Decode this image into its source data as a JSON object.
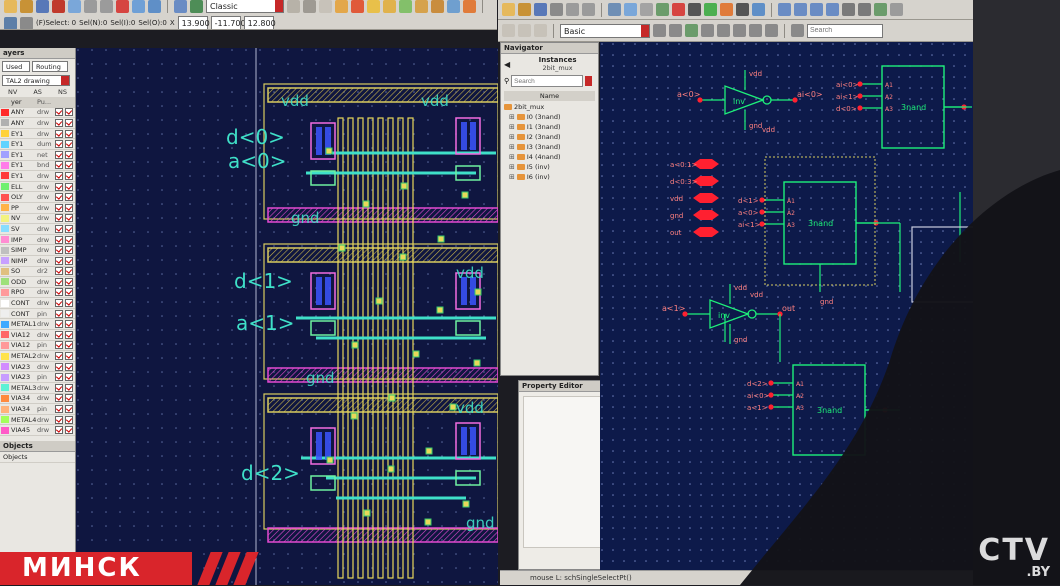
{
  "layout_toolbar": {
    "view_combo": "Classic",
    "coord_labels": [
      "(F)Select: 0",
      "Sel(N):0",
      "Sel(I):0",
      "Sel(O):0",
      "X"
    ],
    "x_value": "13.900",
    "y_value": "-11.700",
    "dist_value": "12.800"
  },
  "schematic_toolbar": {
    "view_combo": "Basic",
    "search_placeholder": "Search"
  },
  "layers_panel": {
    "title": "ayers",
    "filter_used": "Used",
    "filter_routing": "Routing",
    "lpp_combo": "TAL2 drawing",
    "columns": [
      "NV",
      "AS",
      "NS"
    ],
    "header_name": "yer",
    "header_purpose": "Pu...",
    "rows": [
      {
        "name": "ANY",
        "purpose": "drw",
        "color": "#ff2a2a"
      },
      {
        "name": "ANY",
        "purpose": "drw",
        "color": "#b0b0b0"
      },
      {
        "name": "EY1",
        "purpose": "drw",
        "color": "#ffd23a"
      },
      {
        "name": "EY1",
        "purpose": "dum",
        "color": "#5fd3ff"
      },
      {
        "name": "EY1",
        "purpose": "net",
        "color": "#a0a0ff"
      },
      {
        "name": "EY1",
        "purpose": "bnd",
        "color": "#ff7de9"
      },
      {
        "name": "EY1",
        "purpose": "drw",
        "color": "#ff3a3a"
      },
      {
        "name": "ELL",
        "purpose": "drw",
        "color": "#70f070"
      },
      {
        "name": "OLY",
        "purpose": "drw",
        "color": "#ff5050"
      },
      {
        "name": "PP",
        "purpose": "drw",
        "color": "#ffb347"
      },
      {
        "name": "NV",
        "purpose": "drw",
        "color": "#f3f380"
      },
      {
        "name": "SV",
        "purpose": "drw",
        "color": "#88ddff"
      },
      {
        "name": "IMP",
        "purpose": "drw",
        "color": "#ff8cd2"
      },
      {
        "name": "SIMP",
        "purpose": "drw",
        "color": "#bfbfbf"
      },
      {
        "name": "NIMP",
        "purpose": "drw",
        "color": "#c7a0ff"
      },
      {
        "name": "SO",
        "purpose": "dr2",
        "color": "#e0c080"
      },
      {
        "name": "ODD",
        "purpose": "drw",
        "color": "#9fe07a"
      },
      {
        "name": "RPO",
        "purpose": "drw",
        "color": "#ff9a9a"
      },
      {
        "name": "CONT",
        "purpose": "drw",
        "color": "#ffffff"
      },
      {
        "name": "CONT",
        "purpose": "pin",
        "color": "#eeeeee"
      },
      {
        "name": "METAL1",
        "purpose": "drw",
        "color": "#3fa9ff"
      },
      {
        "name": "VIA12",
        "purpose": "drw",
        "color": "#ff6666"
      },
      {
        "name": "VIA12",
        "purpose": "pin",
        "color": "#ff9999"
      },
      {
        "name": "METAL2",
        "purpose": "drw",
        "color": "#ffe34a"
      },
      {
        "name": "VIA23",
        "purpose": "drw",
        "color": "#d28cff"
      },
      {
        "name": "VIA23",
        "purpose": "pin",
        "color": "#c79cff"
      },
      {
        "name": "METAL3",
        "purpose": "drw",
        "color": "#5ff2d5"
      },
      {
        "name": "VIA34",
        "purpose": "drw",
        "color": "#ff8a3d"
      },
      {
        "name": "VIA34",
        "purpose": "pin",
        "color": "#ffb27a"
      },
      {
        "name": "METAL4",
        "purpose": "drw",
        "color": "#a3ff5a"
      },
      {
        "name": "VIA45",
        "purpose": "drw",
        "color": "#ff5ac8"
      }
    ],
    "objects_label": "Objects",
    "objects_sub": "Objects"
  },
  "layout_canvas": {
    "pin_labels": [
      "d<0>",
      "a<0>",
      "d<1>",
      "a<1>",
      "d<2>"
    ],
    "rail_labels": [
      "vdd",
      "vdd",
      "gnd",
      "vdd",
      "gnd",
      "vdd",
      "gnd"
    ]
  },
  "navigator": {
    "title": "Navigator",
    "subtitle": "Instances",
    "cell": "2bit_mux",
    "search_placeholder": "Search",
    "column_header": "Name",
    "root": "2bit_mux",
    "instances": [
      "I0 (3nand)",
      "I1 (3nand)",
      "I2 (3nand)",
      "I3 (3nand)",
      "I4 (4nand)",
      "I5 (inv)",
      "I6 (inv)"
    ]
  },
  "property_editor": {
    "title": "Property Editor"
  },
  "schematic": {
    "inv_top": {
      "label": "inv",
      "in": "a<0>",
      "out": "ai<0>",
      "vdd": "vdd",
      "gnd": "gnd"
    },
    "inv_mid": {
      "label": "inv",
      "in": "a<1>",
      "out": "out",
      "vdd": "vdd",
      "gnd": "gnd"
    },
    "nand_top_right": {
      "label": "3nand",
      "inputs": [
        "ai<0>",
        "ai<1>",
        "d<0>"
      ],
      "pins": [
        "A1",
        "A2",
        "A3"
      ]
    },
    "nand_center": {
      "label": "3nand",
      "inputs": [
        "d<1>",
        "a<0>",
        "ai<1>"
      ],
      "pins": [
        "A1",
        "A2",
        "A3"
      ]
    },
    "nand_bottom": {
      "label": "3nand",
      "inputs": [
        "d<2>",
        "ai<0>",
        "a<1>"
      ],
      "pins": [
        "A1",
        "A2",
        "A3"
      ]
    },
    "io_pins": [
      "a<0:1>",
      "d<0:3>",
      "vdd",
      "gnd",
      "out"
    ],
    "wire_labels": [
      "vdd",
      "vdd",
      "gnd"
    ]
  },
  "status": {
    "text": "mouse L: schSingleSelectPt()"
  },
  "overlay": {
    "city": "МИНСК",
    "logo_main": "CTV",
    "logo_sub": ".BY"
  },
  "colors": {
    "canvas_bg": "#0f1640",
    "schematic_bg": "#0d1a4a",
    "wire_green": "#1ef07a",
    "pin_red": "#ff2030",
    "accent_red": "#d9252b"
  }
}
